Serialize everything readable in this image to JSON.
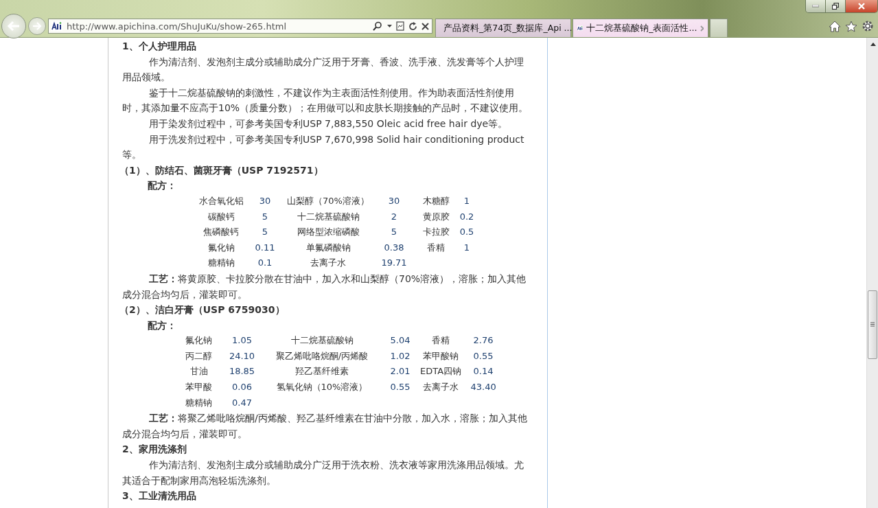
{
  "browser": {
    "address_bar": {
      "url": "http://www.apichina.com/ShuJuKu/show-265.html"
    },
    "tabs": [
      {
        "title": "产品资料_第74页_数据库_Api ...",
        "selected": false
      },
      {
        "title": "十二烷基硫酸钠_表面活性...",
        "selected": true
      }
    ]
  },
  "content": [
    {
      "kind": "heading",
      "text": "1、个人护理用品"
    },
    {
      "kind": "paragraph",
      "text": "作为清洁剂、发泡剂主成分或辅助成分广泛用于牙膏、香波、洗手液、洗发膏等个人护理用品领域。"
    },
    {
      "kind": "paragraph",
      "text": "鉴于十二烷基硫酸钠的刺激性，不建议作为主表面活性剂使用。作为助表面活性剂使用时，其添加量不应高于10%（质量分数）；在用做可以和皮肤长期接触的产品时，不建议使用。"
    },
    {
      "kind": "paragraph",
      "text": "用于染发剂过程中，可参考美国专利USP 7,883,550 Oleic acid free hair dye等。"
    },
    {
      "kind": "paragraph",
      "text": "用于洗发剂过程中，可参考美国专利USP 7,670,998 Solid hair conditioning product等。"
    },
    {
      "kind": "subheading",
      "text": "（1）、防结石、菌斑牙膏（USP 7192571）"
    },
    {
      "kind": "label",
      "text": "配方："
    },
    {
      "kind": "recipe",
      "rows": [
        [
          "水合氧化铝",
          "30",
          "山梨醇（70%溶液）",
          "30",
          "木糖醇",
          "1"
        ],
        [
          "碳酸钙",
          "5",
          "十二烷基硫酸钠",
          "2",
          "黄原胶",
          "0.2"
        ],
        [
          "焦磷酸钙",
          "5",
          "网络型浓缩磷酸",
          "5",
          "卡拉胶",
          "0.5"
        ],
        [
          "氟化钠",
          "0.11",
          "单氟磷酸钠",
          "0.38",
          "香精",
          "1"
        ],
        [
          "糖精钠",
          "0.1",
          "去离子水",
          "19.71"
        ]
      ]
    },
    {
      "kind": "paragraph",
      "text": "**工艺：**将黄原胶、卡拉胶分散在甘油中，加入水和山梨醇（70%溶液），溶胀；加入其他成分混合均匀后，灌装即可。"
    },
    {
      "kind": "subheading",
      "text": "（2）、洁白牙膏（USP 6759030）"
    },
    {
      "kind": "label",
      "text": "配方："
    },
    {
      "kind": "recipe",
      "rows": [
        [
          "氟化钠",
          "1.05",
          "十二烷基硫酸钠",
          "5.04",
          "香精",
          "2.76"
        ],
        [
          "丙二醇",
          "24.10",
          "聚乙烯吡咯烷酮/丙烯酸",
          "1.02",
          "苯甲酸钠",
          "0.55"
        ],
        [
          "甘油",
          "18.85",
          "羟乙基纤维素",
          "2.01",
          "EDTA四钠",
          "0.14"
        ],
        [
          "苯甲酸",
          "0.06",
          "氢氧化钠（10%溶液）",
          "0.55",
          "去离子水",
          "43.40"
        ],
        [
          "糖精钠",
          "0.47"
        ]
      ]
    },
    {
      "kind": "paragraph",
      "text": "**工艺：**将聚乙烯吡咯烷酮/丙烯酸、羟乙基纤维素在甘油中分散，加入水，溶胀；加入其他成分混合均匀后，灌装即可。"
    },
    {
      "kind": "heading",
      "text": "2、家用洗涤剂"
    },
    {
      "kind": "paragraph",
      "text": "作为清洁剂、发泡剂主成分或辅助成分广泛用于洗衣粉、洗衣液等家用洗涤用品领域。尤其适合于配制家用高泡轻垢洗涤剂。"
    },
    {
      "kind": "heading",
      "text": "3、工业清洗用品"
    }
  ]
}
